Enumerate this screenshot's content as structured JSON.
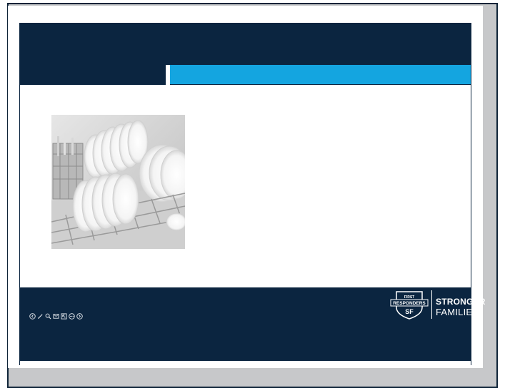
{
  "slide": {
    "photo": {
      "subject": "dishwasher rack loaded with white plates"
    }
  },
  "toolbar": {
    "icons": [
      "arrow-left-icon",
      "pen-icon",
      "zoom-icon",
      "slides-icon",
      "pointer-icon",
      "more-icon",
      "arrow-right-icon"
    ]
  },
  "logo": {
    "badge_top": "FIRST",
    "badge_middle": "RESPONDERS",
    "badge_bottom": "SF",
    "brand_line1": "STRONGER",
    "brand_line2": "FAMILIES"
  },
  "colors": {
    "navy": "#0b2540",
    "accent_blue": "#14a5e0",
    "frame_gray": "#c7c8ca"
  }
}
